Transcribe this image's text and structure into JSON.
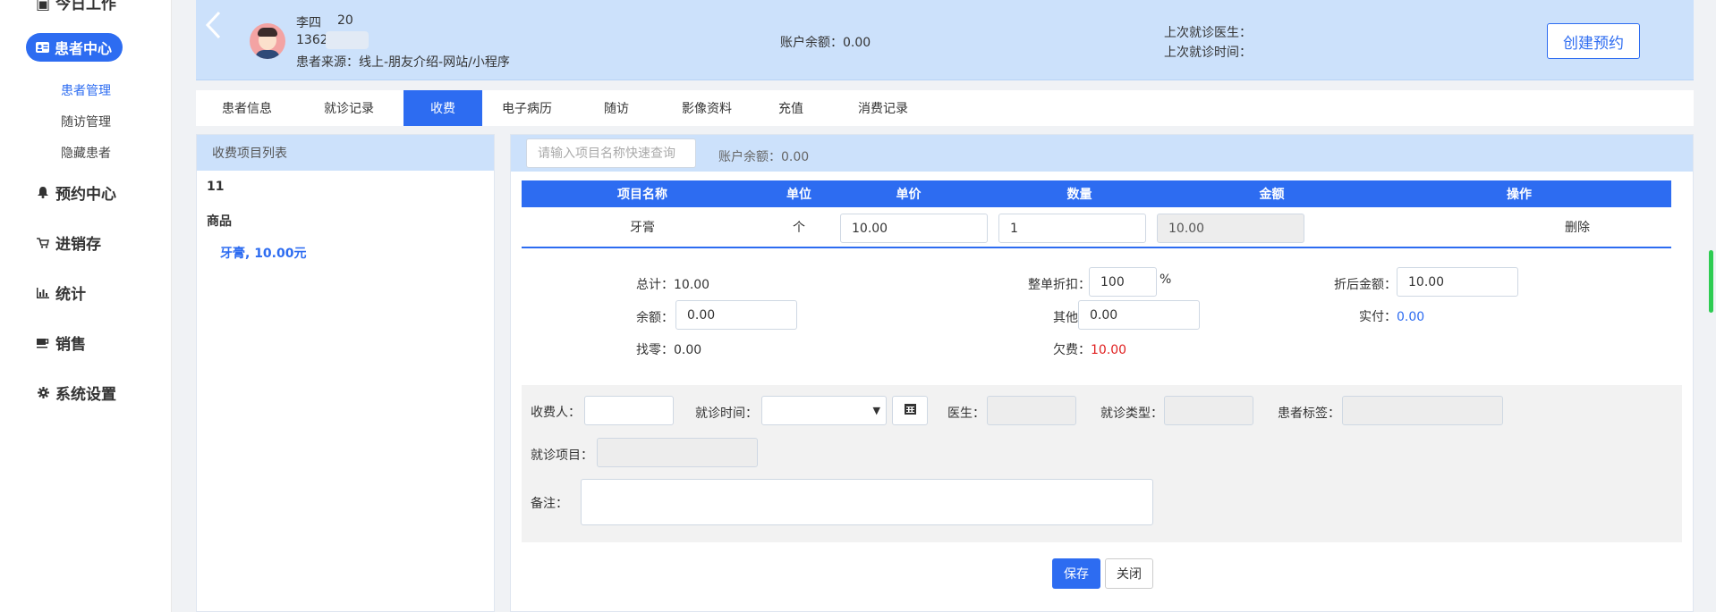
{
  "sidebar": {
    "partial_top": "今日工作",
    "patient_center": "患者中心",
    "sub_items": [
      "患者管理",
      "随访管理",
      "隐藏患者"
    ],
    "appointment_center": "预约中心",
    "inventory": "进销存",
    "statistics": "统计",
    "sales": "销售",
    "settings": "系统设置"
  },
  "header": {
    "name": "李四",
    "age": "20",
    "phone": "1362",
    "source": "患者来源：线上-朋友介绍-网站/小程序",
    "balance": "账户余额：0.00",
    "last_doctor": "上次就诊医生：",
    "last_time": "上次就诊时间：",
    "create_appointment": "创建预约"
  },
  "tabs": [
    "患者信息",
    "就诊记录",
    "收费",
    "电子病历",
    "随访",
    "影像资料",
    "充值",
    "消费记录"
  ],
  "active_tab": "收费",
  "left_panel": {
    "title": "收费项目列表",
    "category1": "11",
    "category2": "商品",
    "product": "牙膏, 10.00元"
  },
  "main": {
    "search_placeholder": "请输入项目名称快速查询",
    "balance": "账户余额：0.00",
    "columns": [
      "项目名称",
      "单位",
      "单价",
      "数量",
      "金额",
      "操作"
    ],
    "row": {
      "name": "牙膏",
      "unit": "个",
      "price": "10.00",
      "qty": "1",
      "amount": "10.00",
      "action": "删除"
    },
    "summary": {
      "total_label": "总计：",
      "total": "10.00",
      "discount_label": "整单折扣：",
      "discount": "100",
      "percent": "%",
      "after_discount_label": "折后金额：",
      "after_discount": "10.00",
      "balance_label": "余额：",
      "balance": "0.00",
      "other_label": "其他：",
      "other": "0.00",
      "paid_label": "实付：",
      "paid": "0.00",
      "change_label": "找零：",
      "change": "0.00",
      "owed_label": "欠费：",
      "owed": "10.00"
    },
    "form": {
      "cashier": "收费人：",
      "visit_time": "就诊时间：",
      "doctor": "医生：",
      "visit_type": "就诊类型：",
      "patient_tag": "患者标签：",
      "visit_item": "就诊项目：",
      "remark": "备注："
    },
    "save": "保存",
    "close": "关闭"
  },
  "colors": {
    "accent": "#2d6cf1",
    "header_bg": "#cce1fb",
    "owed": "#e02020"
  }
}
